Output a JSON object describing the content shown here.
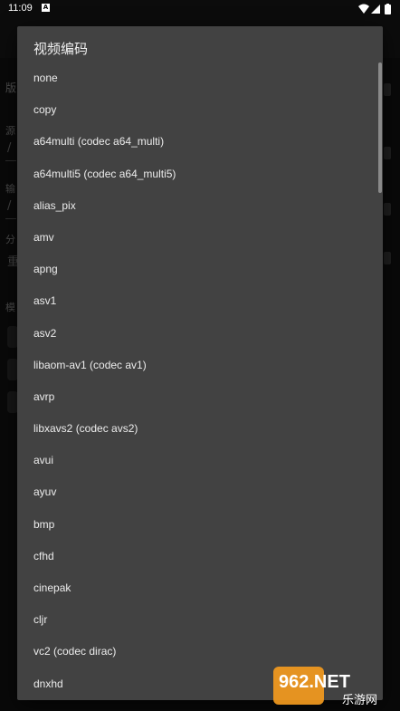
{
  "status_bar": {
    "time": "11:09",
    "notification_icon": "A",
    "icons": [
      "wifi-icon",
      "signal-icon",
      "battery-icon"
    ]
  },
  "background": {
    "labels": [
      "版",
      "源",
      "输",
      "分",
      "模"
    ],
    "values": [
      "/",
      "/",
      "重"
    ]
  },
  "dialog": {
    "title": "视频编码",
    "options": [
      "none",
      "copy",
      "a64multi (codec a64_multi)",
      "a64multi5 (codec a64_multi5)",
      "alias_pix",
      "amv",
      "apng",
      "asv1",
      "asv2",
      "libaom-av1 (codec av1)",
      "avrp",
      "libxavs2 (codec avs2)",
      "avui",
      "ayuv",
      "bmp",
      "cfhd",
      "cinepak",
      "cljr",
      "vc2 (codec dirac)",
      "dnxhd"
    ]
  },
  "watermark": {
    "brand": "962.NET",
    "caption": "乐游网"
  },
  "colors": {
    "dialog_bg": "#424242",
    "scrim": "#000000",
    "watermark_orange": "#f39a1e",
    "watermark_blue": "#2f7fd3"
  }
}
